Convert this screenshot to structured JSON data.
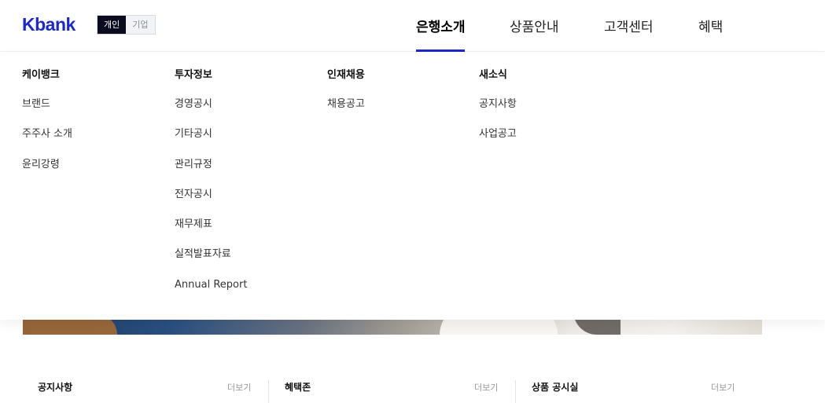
{
  "header": {
    "logo": "Kbank",
    "segments": [
      {
        "label": "개인",
        "active": true
      },
      {
        "label": "기업",
        "active": false
      }
    ],
    "nav": [
      {
        "label": "은행소개",
        "active": true
      },
      {
        "label": "상품안내",
        "active": false
      },
      {
        "label": "고객센터",
        "active": false
      },
      {
        "label": "혜택",
        "active": false
      }
    ],
    "accent_color": "#1e29c5"
  },
  "mega_menu": {
    "columns": [
      {
        "title": "케이뱅크",
        "links": [
          "브랜드",
          "주주사 소개",
          "윤리강령"
        ]
      },
      {
        "title": "투자정보",
        "links": [
          "경영공시",
          "기타공시",
          "관리규정",
          "전자공시",
          "재무제표",
          "실적발표자료",
          "Annual Report"
        ]
      },
      {
        "title": "인재채용",
        "links": [
          "채용공고"
        ]
      },
      {
        "title": "새소식",
        "links": [
          "공지사항",
          "사업공고"
        ]
      }
    ]
  },
  "boards": [
    {
      "title": "공지사항",
      "more": "더보기"
    },
    {
      "title": "혜택존",
      "more": "더보기"
    },
    {
      "title": "상품 공시실",
      "more": "더보기"
    }
  ]
}
